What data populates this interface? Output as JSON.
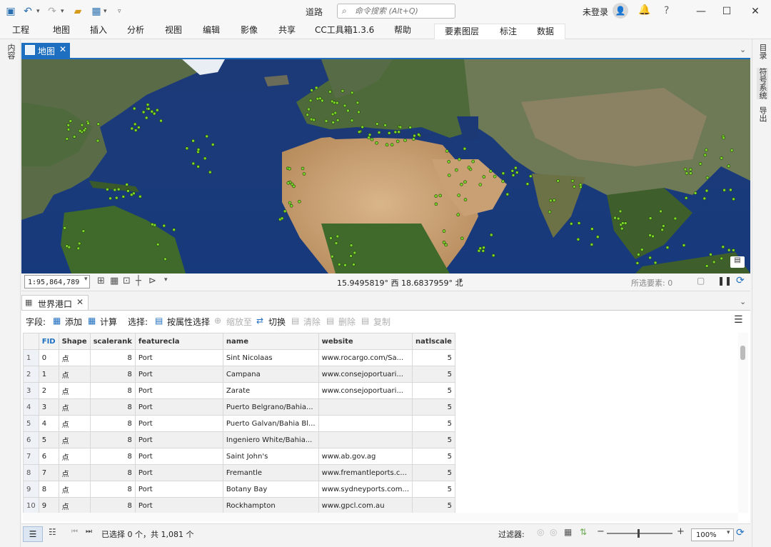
{
  "titlebar": {
    "title": "道路",
    "search_placeholder": "命令搜索 (Alt+Q)",
    "user_label": "未登录"
  },
  "ribbon": {
    "tabs": [
      "工程",
      "地图",
      "插入",
      "分析",
      "视图",
      "编辑",
      "影像",
      "共享",
      "CC工具箱1.3.6",
      "帮助"
    ],
    "context_tabs": [
      "要素图层",
      "标注",
      "数据"
    ]
  },
  "left_pane": {
    "label": "内容"
  },
  "right_pane": {
    "labels": [
      "目录",
      "符号系统",
      "导出"
    ]
  },
  "map_view": {
    "tab_label": "地图"
  },
  "map_status": {
    "scale": "1:95,864,789",
    "coordinates": "15.9495819° 西  18.6837959° 北",
    "selected_features": "所选要素: 0"
  },
  "attribute_table": {
    "tab_label": "世界港口",
    "toolbar": {
      "field_label": "字段:",
      "add": "添加",
      "calculate": "计算",
      "select_label": "选择:",
      "select_by_attr": "按属性选择",
      "zoom_to": "缩放至",
      "switch": "切换",
      "clear": "清除",
      "delete": "删除",
      "copy": "复制"
    },
    "columns": [
      "FID",
      "Shape",
      "scalerank",
      "featurecla",
      "name",
      "website",
      "natlscale"
    ],
    "rows": [
      [
        "1",
        "0",
        "点",
        "8",
        "Port",
        "Sint Nicolaas",
        "www.rocargo.com/Sa...",
        "5"
      ],
      [
        "2",
        "1",
        "点",
        "8",
        "Port",
        "Campana",
        "www.consejoportuari...",
        "5"
      ],
      [
        "3",
        "2",
        "点",
        "8",
        "Port",
        "Zarate",
        "www.consejoportuari...",
        "5"
      ],
      [
        "4",
        "3",
        "点",
        "8",
        "Port",
        "Puerto Belgrano/Bahia...",
        "",
        "5"
      ],
      [
        "5",
        "4",
        "点",
        "8",
        "Port",
        "Puerto Galvan/Bahia Bl...",
        "",
        "5"
      ],
      [
        "6",
        "5",
        "点",
        "8",
        "Port",
        "Ingeniero White/Bahia...",
        "",
        "5"
      ],
      [
        "7",
        "6",
        "点",
        "8",
        "Port",
        "Saint John's",
        "www.ab.gov.ag",
        "5"
      ],
      [
        "8",
        "7",
        "点",
        "8",
        "Port",
        "Fremantle",
        "www.fremantleports.c...",
        "5"
      ],
      [
        "9",
        "8",
        "点",
        "8",
        "Port",
        "Botany Bay",
        "www.sydneyports.com...",
        "5"
      ],
      [
        "10",
        "9",
        "点",
        "8",
        "Port",
        "Rockhampton",
        "www.gpcl.com.au",
        "5"
      ]
    ],
    "status_text": "已选择 0 个，共 1,081 个",
    "filter_label": "过滤器:",
    "zoom": "100%"
  }
}
